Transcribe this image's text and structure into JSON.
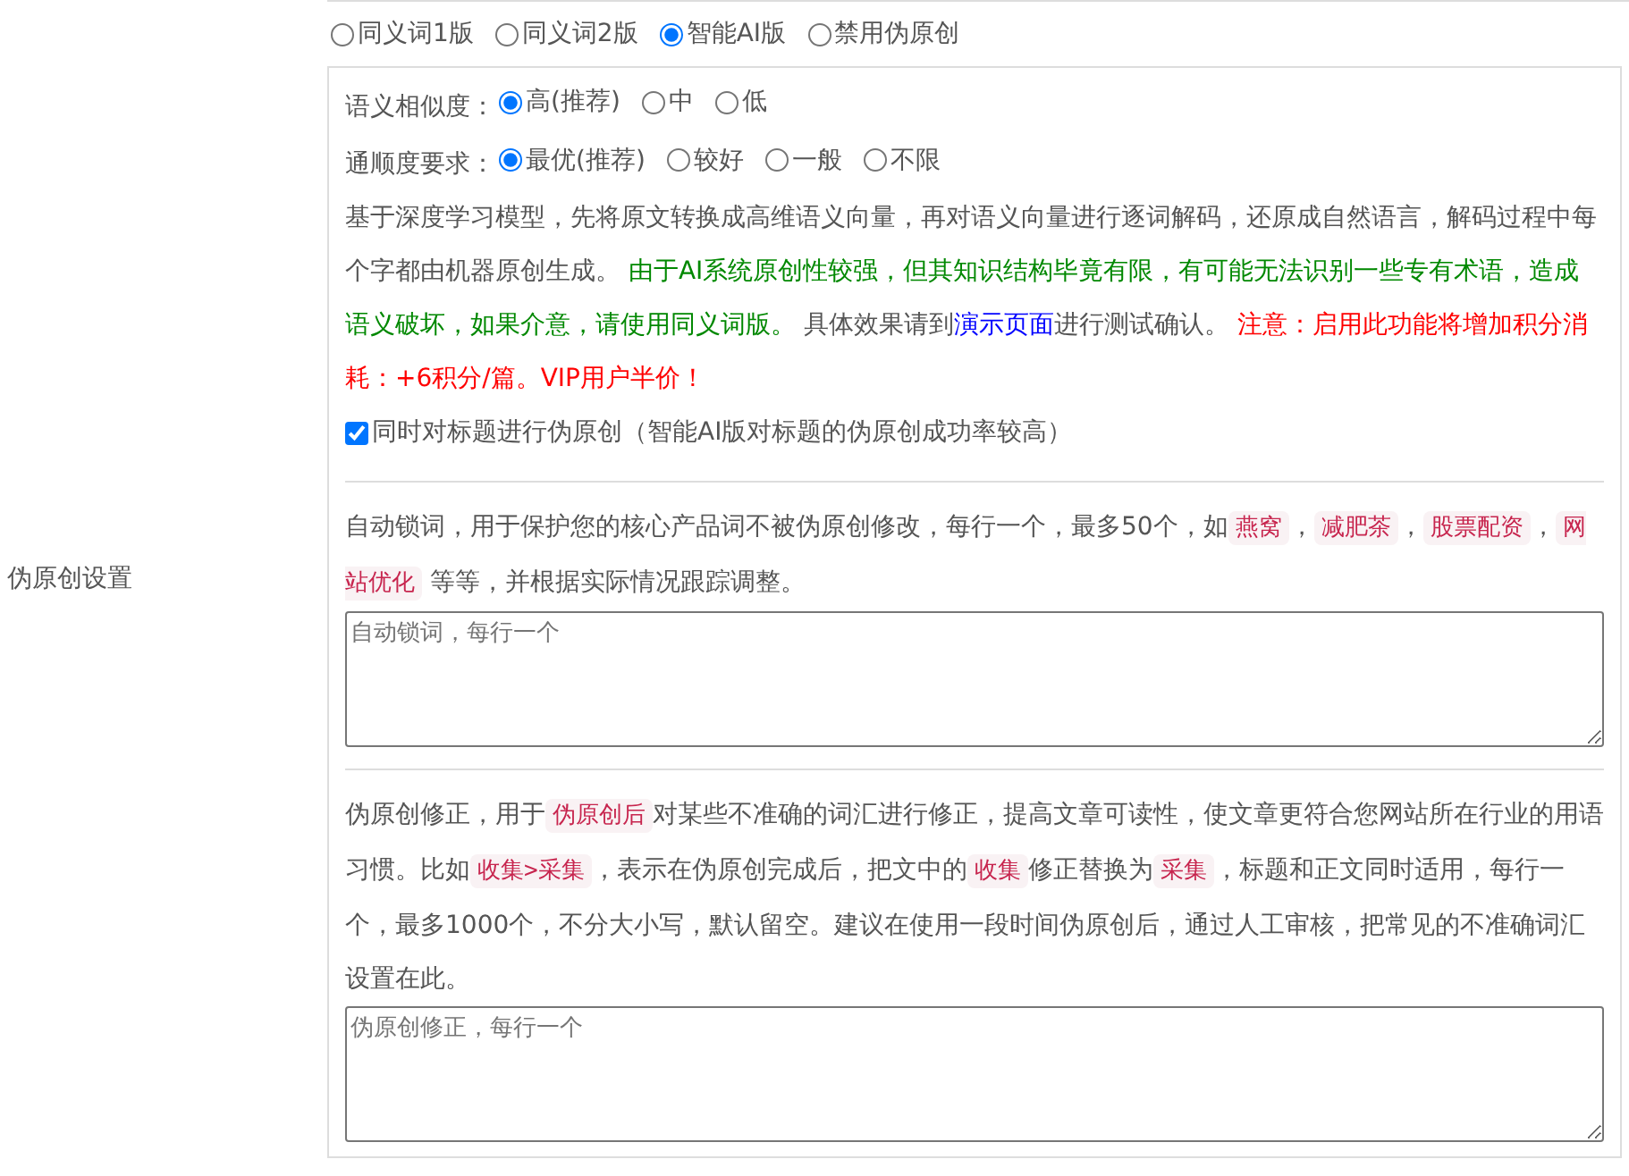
{
  "row_label": "伪原创设置",
  "modes": [
    {
      "label": "同义词1版",
      "selected": false
    },
    {
      "label": "同义词2版",
      "selected": false
    },
    {
      "label": "智能AI版",
      "selected": true
    },
    {
      "label": "禁用伪原创",
      "selected": false
    }
  ],
  "similarity": {
    "label": "语义相似度：",
    "options": [
      {
        "label": "高(推荐)",
        "selected": true
      },
      {
        "label": "中",
        "selected": false
      },
      {
        "label": "低",
        "selected": false
      }
    ]
  },
  "fluency": {
    "label": "通顺度要求：",
    "options": [
      {
        "label": "最优(推荐)",
        "selected": true
      },
      {
        "label": "较好",
        "selected": false
      },
      {
        "label": "一般",
        "selected": false
      },
      {
        "label": "不限",
        "selected": false
      }
    ]
  },
  "description": [
    {
      "kind": "text",
      "text": "基于深度学习模型，先将原文转换成高维语义向量，再对语义向量进行逐词解码，还原成自然语言，解码过程中每个字都由机器原创生成。 "
    },
    {
      "kind": "note",
      "text": "由于AI系统原创性较强，但其知识结构毕竟有限，有可能无法识别一些专有术语，造成语义破坏，如果介意，请使用同义词版。"
    },
    {
      "kind": "text",
      "text": " 具体效果请到"
    },
    {
      "kind": "link",
      "text": "演示页面"
    },
    {
      "kind": "text",
      "text": "进行测试确认。 "
    },
    {
      "kind": "warning",
      "text": "注意：启用此功能将增加积分消耗：+6积分/篇。VIP用户半价！"
    }
  ],
  "title_option": {
    "label": "同时对标题进行伪原创（智能AI版对标题的伪原创成功率较高）",
    "checked": true
  },
  "lock_words": {
    "description": [
      {
        "kind": "text",
        "text": "自动锁词，用于保护您的核心产品词不被伪原创修改，每行一个，最多50个，如"
      },
      {
        "kind": "code",
        "text": "燕窝"
      },
      {
        "kind": "text",
        "text": "，"
      },
      {
        "kind": "code",
        "text": "减肥茶"
      },
      {
        "kind": "text",
        "text": "，"
      },
      {
        "kind": "code",
        "text": "股票配资"
      },
      {
        "kind": "text",
        "text": "，"
      },
      {
        "kind": "code",
        "text": "网站优化"
      },
      {
        "kind": "text",
        "text": " 等等，并根据实际情况跟踪调整。"
      }
    ],
    "placeholder": "自动锁词，每行一个"
  },
  "corrections": {
    "description": [
      {
        "kind": "text",
        "text": "伪原创修正，用于"
      },
      {
        "kind": "code",
        "text": "伪原创后"
      },
      {
        "kind": "text",
        "text": "对某些不准确的词汇进行修正，提高文章可读性，使文章更符合您网站所在行业的用语习惯。比如"
      },
      {
        "kind": "code",
        "text": "收集>采集"
      },
      {
        "kind": "text",
        "text": "，表示在伪原创完成后，把文中的"
      },
      {
        "kind": "code",
        "text": "收集"
      },
      {
        "kind": "text",
        "text": "修正替换为"
      },
      {
        "kind": "code",
        "text": "采集"
      },
      {
        "kind": "text",
        "text": "，标题和正文同时适用，每行一个，最多1000个，不分大小写，默认留空。建议在使用一段时间伪原创后，通过人工审核，把常见的不准确词汇设置在此。"
      }
    ],
    "placeholder": "伪原创修正，每行一个"
  }
}
